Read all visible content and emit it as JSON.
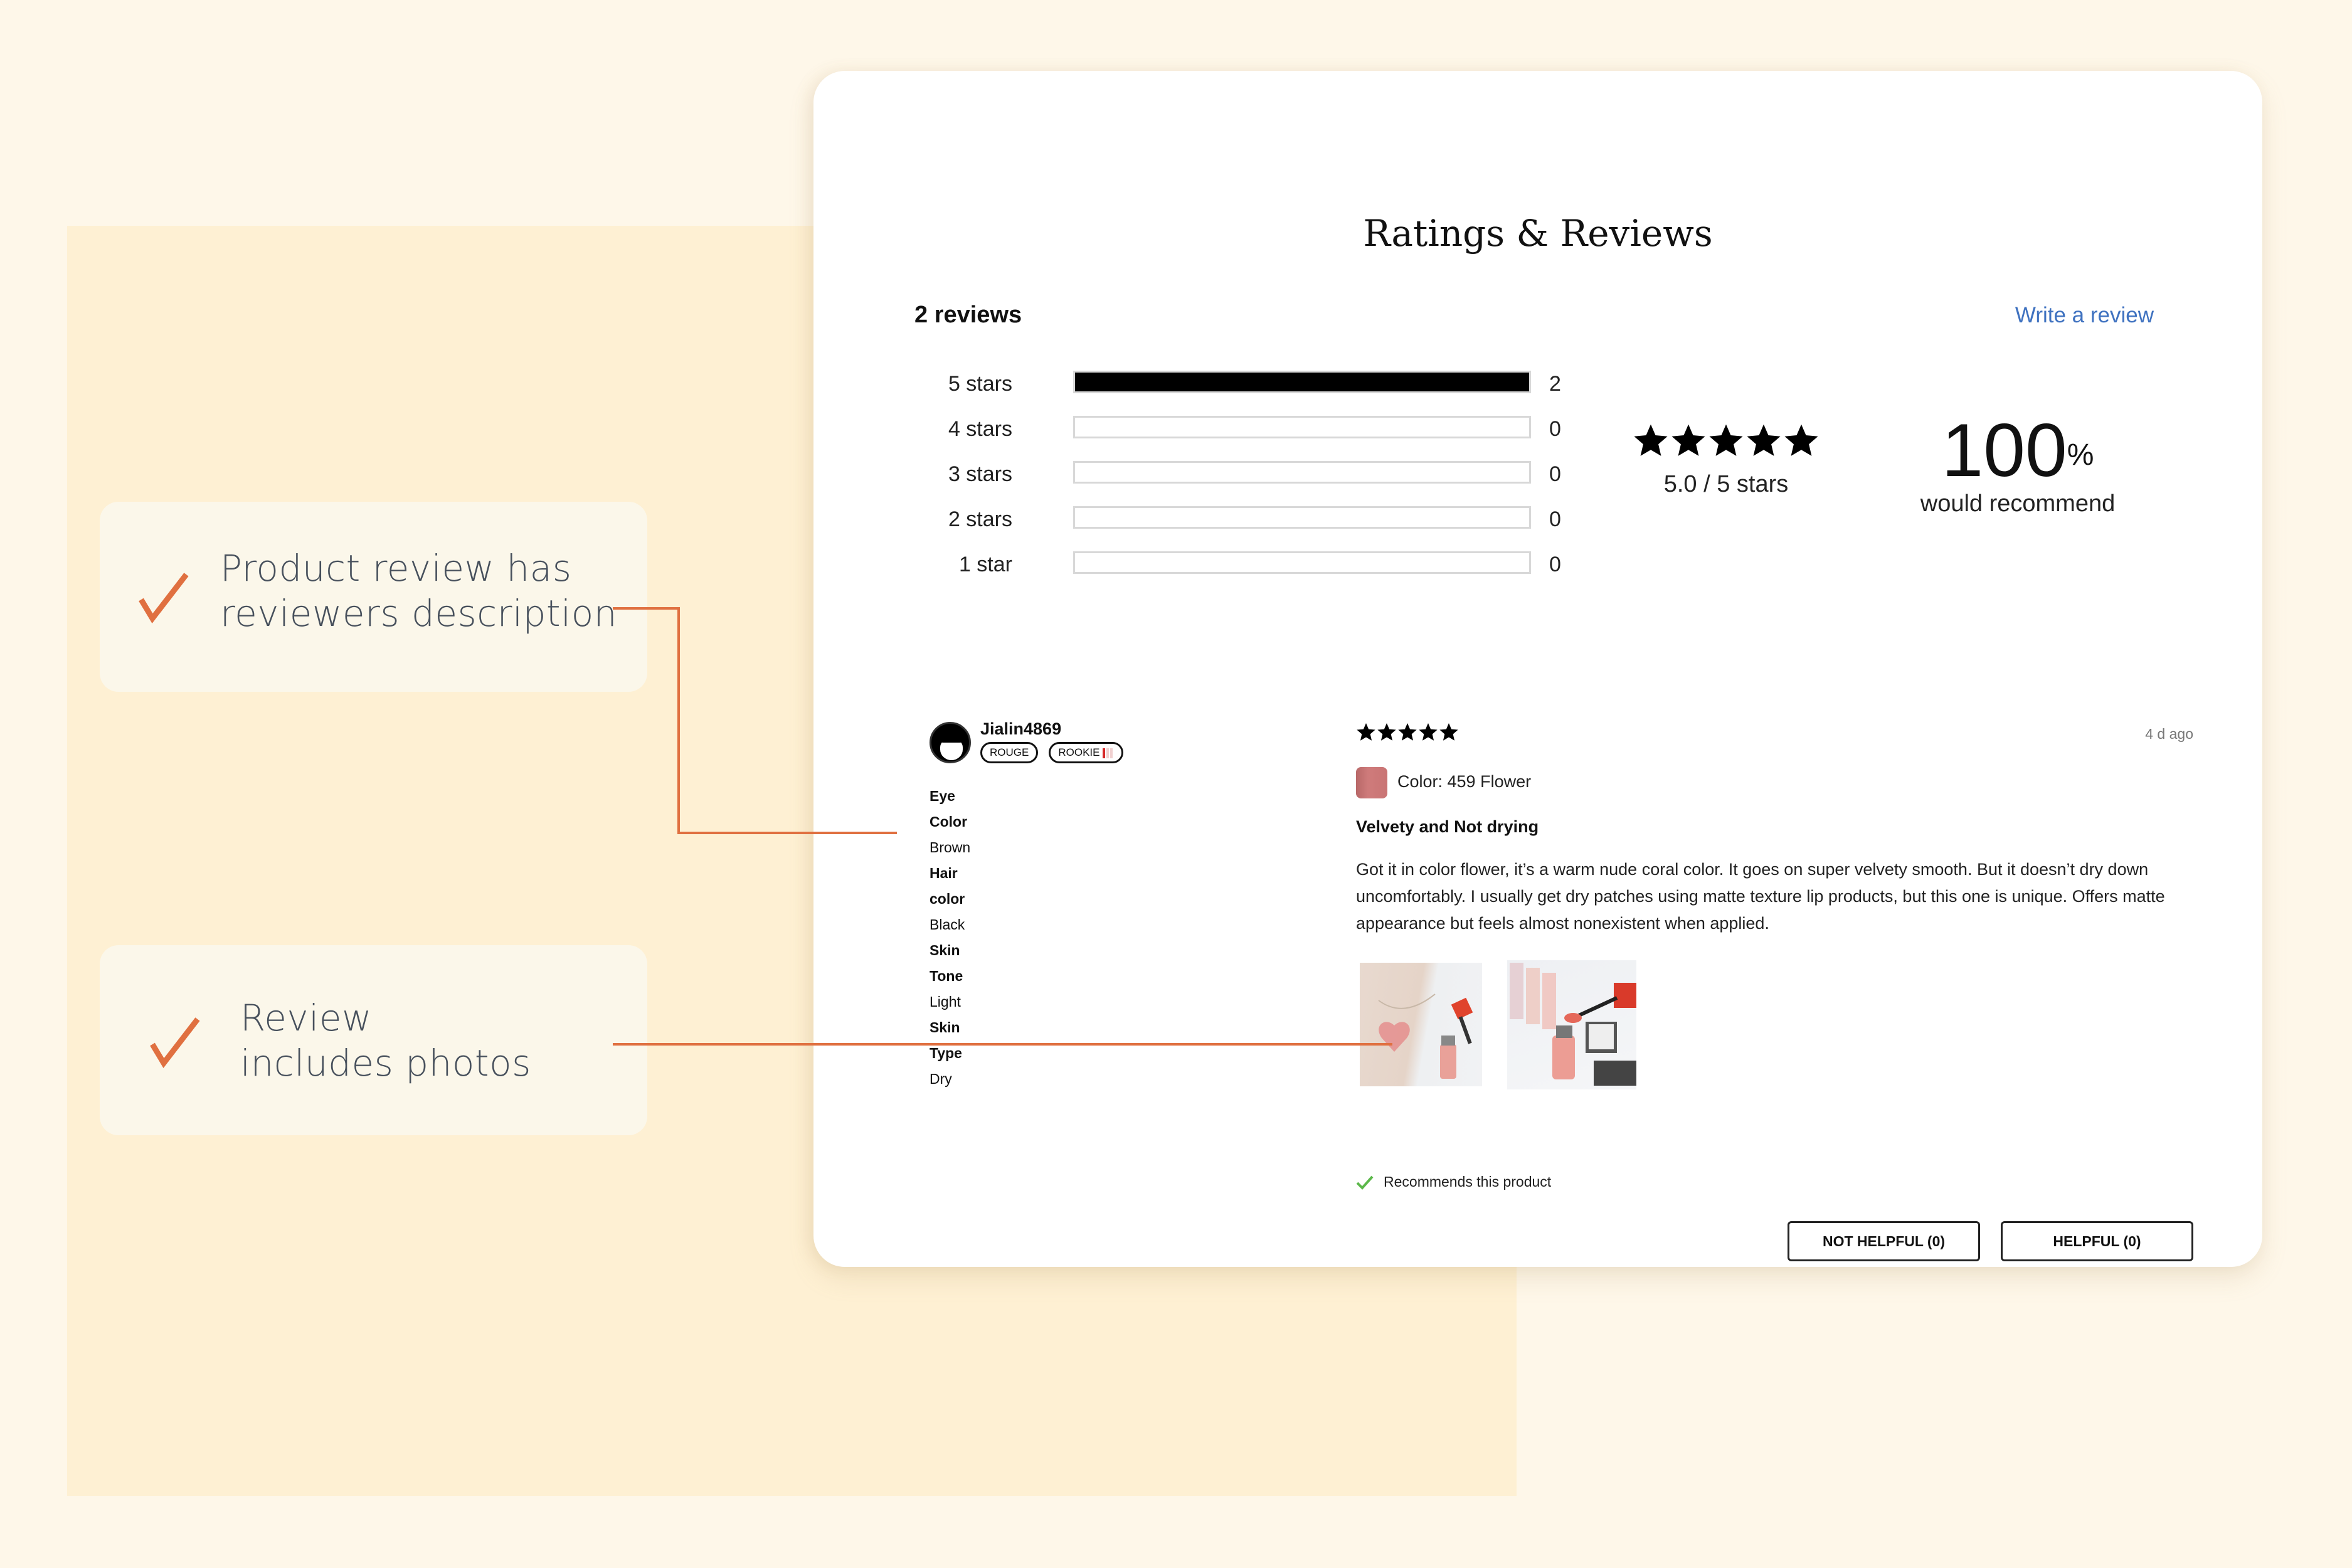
{
  "callouts": [
    {
      "icon": "checkmark-icon",
      "lines": [
        "Product review has",
        "reviewers description"
      ]
    },
    {
      "icon": "checkmark-icon",
      "lines": [
        "Review",
        "includes photos"
      ]
    }
  ],
  "colors": {
    "background": "#fef7e9",
    "panel_background": "#fef0d3",
    "callout_background": "#fbf7ea",
    "accent": "#e07040",
    "callout_text": "#47505c",
    "link": "#3f72c0",
    "recommend_check": "#5cb84a",
    "swatch": "#c97474",
    "badge_meter": "#d72a2a"
  },
  "reviews_widget": {
    "title": "Ratings & Reviews",
    "review_count": "2 reviews",
    "write_review_label": "Write a review",
    "histogram": [
      {
        "label": "5 stars",
        "count": 2,
        "fraction": 1.0
      },
      {
        "label": "4 stars",
        "count": 0,
        "fraction": 0
      },
      {
        "label": "3 stars",
        "count": 0,
        "fraction": 0
      },
      {
        "label": "2 stars",
        "count": 0,
        "fraction": 0
      },
      {
        "label": "1 star",
        "count": 0,
        "fraction": 0
      }
    ],
    "average": {
      "stars": 5,
      "text": "5.0 / 5 stars"
    },
    "recommend": {
      "value": "100",
      "unit": "%",
      "text": "would recommend"
    }
  },
  "review": {
    "username": "Jialin4869",
    "avatar_icon": "avatar-face-icon",
    "badges": [
      {
        "label": "ROUGE"
      },
      {
        "label": "ROOKIE",
        "meter_level": 1,
        "meter_max": 3
      }
    ],
    "traits": [
      {
        "label": "Eye Color",
        "value": "Brown"
      },
      {
        "label": "Hair color",
        "value": "Black"
      },
      {
        "label": "Skin Tone",
        "value": "Light"
      },
      {
        "label": "Skin Type",
        "value": "Dry"
      }
    ],
    "stars": 5,
    "date": "4 d ago",
    "color_label": "Color: 459 Flower",
    "title": "Velvety and Not drying",
    "body": "Got it in color flower, it’s a warm nude coral color. It goes on super velvety smooth. But it doesn’t dry down uncomfortably. I usually get dry patches using matte texture lip products, but this one is unique. Offers matte appearance but feels almost nonexistent when applied.",
    "photos": [
      {
        "description": "arm swatch heart with lip product"
      },
      {
        "description": "lip products and eyeshadow palette"
      }
    ],
    "recommends_text": "Recommends this product",
    "not_helpful_label": "NOT HELPFUL (0)",
    "helpful_label": "HELPFUL (0)"
  }
}
